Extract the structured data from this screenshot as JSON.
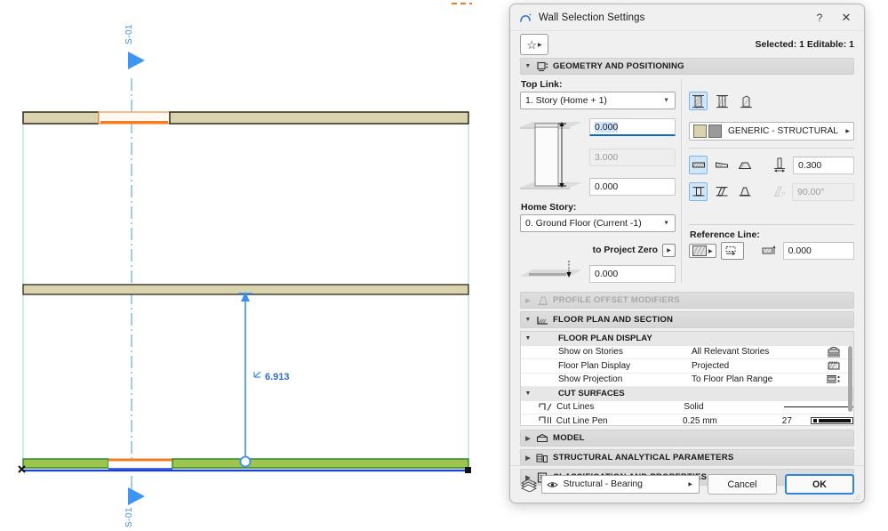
{
  "app": {
    "dialog_title": "Wall Selection Settings",
    "help_icon": "?",
    "close_icon": "✕",
    "selected_info": "Selected: 1 Editable: 1",
    "favorites_icon": "star-icon"
  },
  "sections": {
    "geometry": {
      "label": "GEOMETRY AND POSITIONING",
      "expanded": true
    },
    "profile_offset": {
      "label": "PROFILE OFFSET MODIFIERS",
      "expanded": false,
      "disabled": true
    },
    "floor_plan_section": {
      "label": "FLOOR PLAN AND SECTION",
      "expanded": true
    },
    "model": {
      "label": "MODEL",
      "expanded": false
    },
    "structural": {
      "label": "STRUCTURAL ANALYTICAL PARAMETERS",
      "expanded": false
    },
    "classification": {
      "label": "CLASSIFICATION AND PROPERTIES",
      "expanded": false
    }
  },
  "geometry": {
    "top_link_label": "Top Link:",
    "top_link_value": "1. Story (Home + 1)",
    "height_top_value": "0.000",
    "height_mid_value": "3.000",
    "height_bottom_value": "0.000",
    "home_story_label": "Home Story:",
    "home_story_value": "0. Ground Floor (Current -1)",
    "project_zero_label": "to Project Zero",
    "project_zero_value": "0.000",
    "structure_buttons": [
      "basic-wall-icon",
      "composite-wall-icon",
      "complex-profile-wall-icon"
    ],
    "structure_selected_index": 0,
    "material_name": "GENERIC - STRUCTURAL",
    "geometry_method_buttons": [
      "straight-wall-icon",
      "trapezoid-wall-icon",
      "polygon-wall-icon"
    ],
    "geometry_method_selected_index": 0,
    "thickness_value": "0.300",
    "slant_buttons": [
      "vertical-wall-icon",
      "slanted-wall-icon",
      "double-slanted-wall-icon"
    ],
    "slant_selected_index": 0,
    "slant_angle_value": "90.00°",
    "reference_line_label": "Reference Line:",
    "reference_line_offset": "0.000"
  },
  "floor_plan": {
    "groups": [
      {
        "label": "FLOOR PLAN DISPLAY",
        "expanded": true
      },
      {
        "label": "CUT SURFACES",
        "expanded": true
      }
    ],
    "rows": [
      {
        "group": "FLOOR PLAN DISPLAY",
        "name": "Show on Stories",
        "value": "All Relevant Stories",
        "num": "",
        "icon": "stories-icon"
      },
      {
        "group": "FLOOR PLAN DISPLAY",
        "name": "Floor Plan Display",
        "value": "Projected",
        "num": "",
        "icon": "projected-icon"
      },
      {
        "group": "FLOOR PLAN DISPLAY",
        "name": "Show Projection",
        "value": "To Floor Plan Range",
        "num": "",
        "icon": "projection-range-icon"
      },
      {
        "group": "CUT SURFACES",
        "name": "Cut Lines",
        "value": "Solid",
        "num": "",
        "icon": "cut-lines-icon"
      },
      {
        "group": "CUT SURFACES",
        "name": "Cut Line Pen",
        "value": "0.25 mm",
        "num": "27",
        "icon": "cut-line-pen-icon"
      }
    ]
  },
  "footer": {
    "layer_icon": "layers-icon",
    "eye_icon": "eye-icon",
    "layer_value": "Structural - Bearing",
    "cancel_label": "Cancel",
    "ok_label": "OK"
  },
  "cad": {
    "section_marker_top_label": "S-01",
    "section_marker_bottom_label": "S-01",
    "dimension_value": "6.913",
    "dimension_icon": "angle-dimension-icon",
    "colors": {
      "wall_fill": "#d9d4ae",
      "wall_outline": "#3a3328",
      "highlight_orange": "#f57c20",
      "highlight_orange_light": "#ffc69a",
      "selection_blue": "#3d8ef0",
      "green_wall": "#8cc152",
      "green_outline": "#2d8a2d",
      "blue_line": "#1a3fd0",
      "guide_cyan": "#9fd9d0",
      "marker_blue": "#4da3f5"
    }
  }
}
